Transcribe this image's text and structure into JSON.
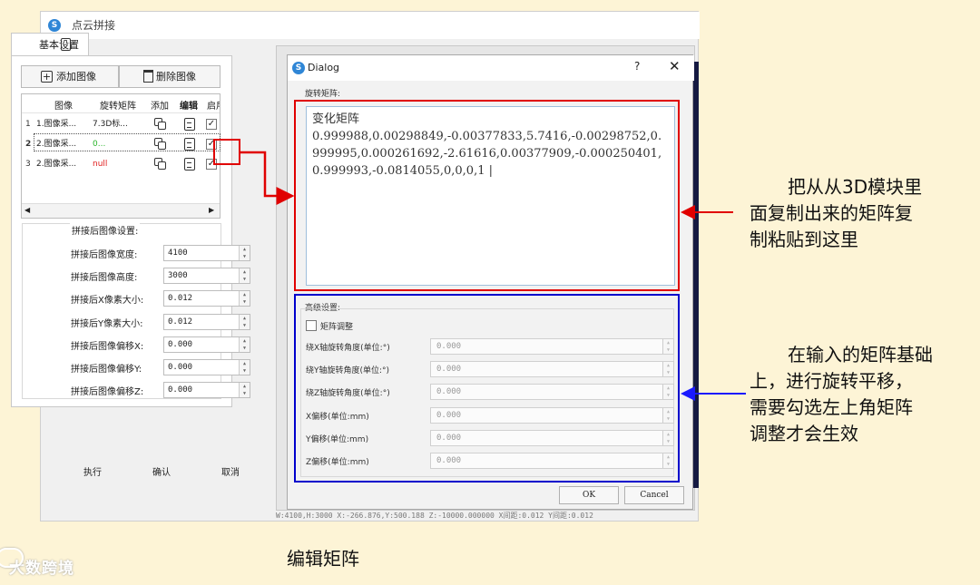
{
  "main_window": {
    "title": "点云拼接",
    "tab_basic": "基本设置",
    "add_image": "添加图像",
    "delete_image": "删除图像",
    "table": {
      "headers": [
        "图像",
        "旋转矩阵",
        "添加",
        "编辑",
        "启用"
      ],
      "rows": [
        {
          "num": "1",
          "image": "1.图像采...",
          "matrix": "7.3D标..."
        },
        {
          "num": "2",
          "image": "2.图像采...",
          "matrix": "0..."
        },
        {
          "num": "3",
          "image": "2.图像采...",
          "matrix": "null"
        }
      ]
    },
    "settings_title": "拼接后图像设置:",
    "settings": [
      {
        "label": "拼接后图像宽度:",
        "value": "4100"
      },
      {
        "label": "拼接后图像高度:",
        "value": "3000"
      },
      {
        "label": "拼接后X像素大小:",
        "value": "0.012"
      },
      {
        "label": "拼接后Y像素大小:",
        "value": "0.012"
      },
      {
        "label": "拼接后图像偏移X:",
        "value": "0.000"
      },
      {
        "label": "拼接后图像偏移Y:",
        "value": "0.000"
      },
      {
        "label": "拼接后图像偏移Z:",
        "value": "0.000"
      }
    ],
    "execute": "执行",
    "confirm": "确认",
    "cancel": "取消"
  },
  "dialog": {
    "title": "Dialog",
    "help": "?",
    "close": "✕",
    "rotation_label": "旋转矩阵:",
    "matrix_text": "变化矩阵\n0.999988,0.00298849,-0.00377833,5.7416,-0.00298752,0.999995,0.000261692,-2.61616,0.00377909,-0.000250401,0.999993,-0.0814055,0,0,0,1 |",
    "advanced_label": "高级设置:",
    "matrix_adjust": "矩阵调整",
    "fields": [
      {
        "label": "绕X轴旋转角度(单位:°)",
        "value": "0.000"
      },
      {
        "label": "绕Y轴旋转角度(单位:°)",
        "value": "0.000"
      },
      {
        "label": "绕Z轴旋转角度(单位:°)",
        "value": "0.000"
      },
      {
        "label": "X偏移(单位:mm)",
        "value": "0.000"
      },
      {
        "label": "Y偏移(单位:mm)",
        "value": "0.000"
      },
      {
        "label": "Z偏移(单位:mm)",
        "value": "0.000"
      }
    ],
    "ok": "OK",
    "cancel": "Cancel"
  },
  "status_strip": "W:4100,H:3000 X:-266.876,Y:500.188 Z:-10000.000000 X间距:0.012 Y间距:0.012",
  "annotations": {
    "note_top": [
      "把从从3D模块里",
      "面复制出来的矩阵复",
      "制粘贴到这里"
    ],
    "note_bottom": [
      "在输入的矩阵基础",
      "上，进行旋转平移，",
      "需要勾选左上角矩阵",
      "调整才会生效"
    ]
  },
  "caption": "编辑矩阵",
  "watermark": "大数跨境",
  "colors": {
    "highlight_red": "#e00000",
    "highlight_blue": "#0000cc",
    "arrow_blue": "#1a1aff",
    "page_bg": "#fdf4d6"
  }
}
